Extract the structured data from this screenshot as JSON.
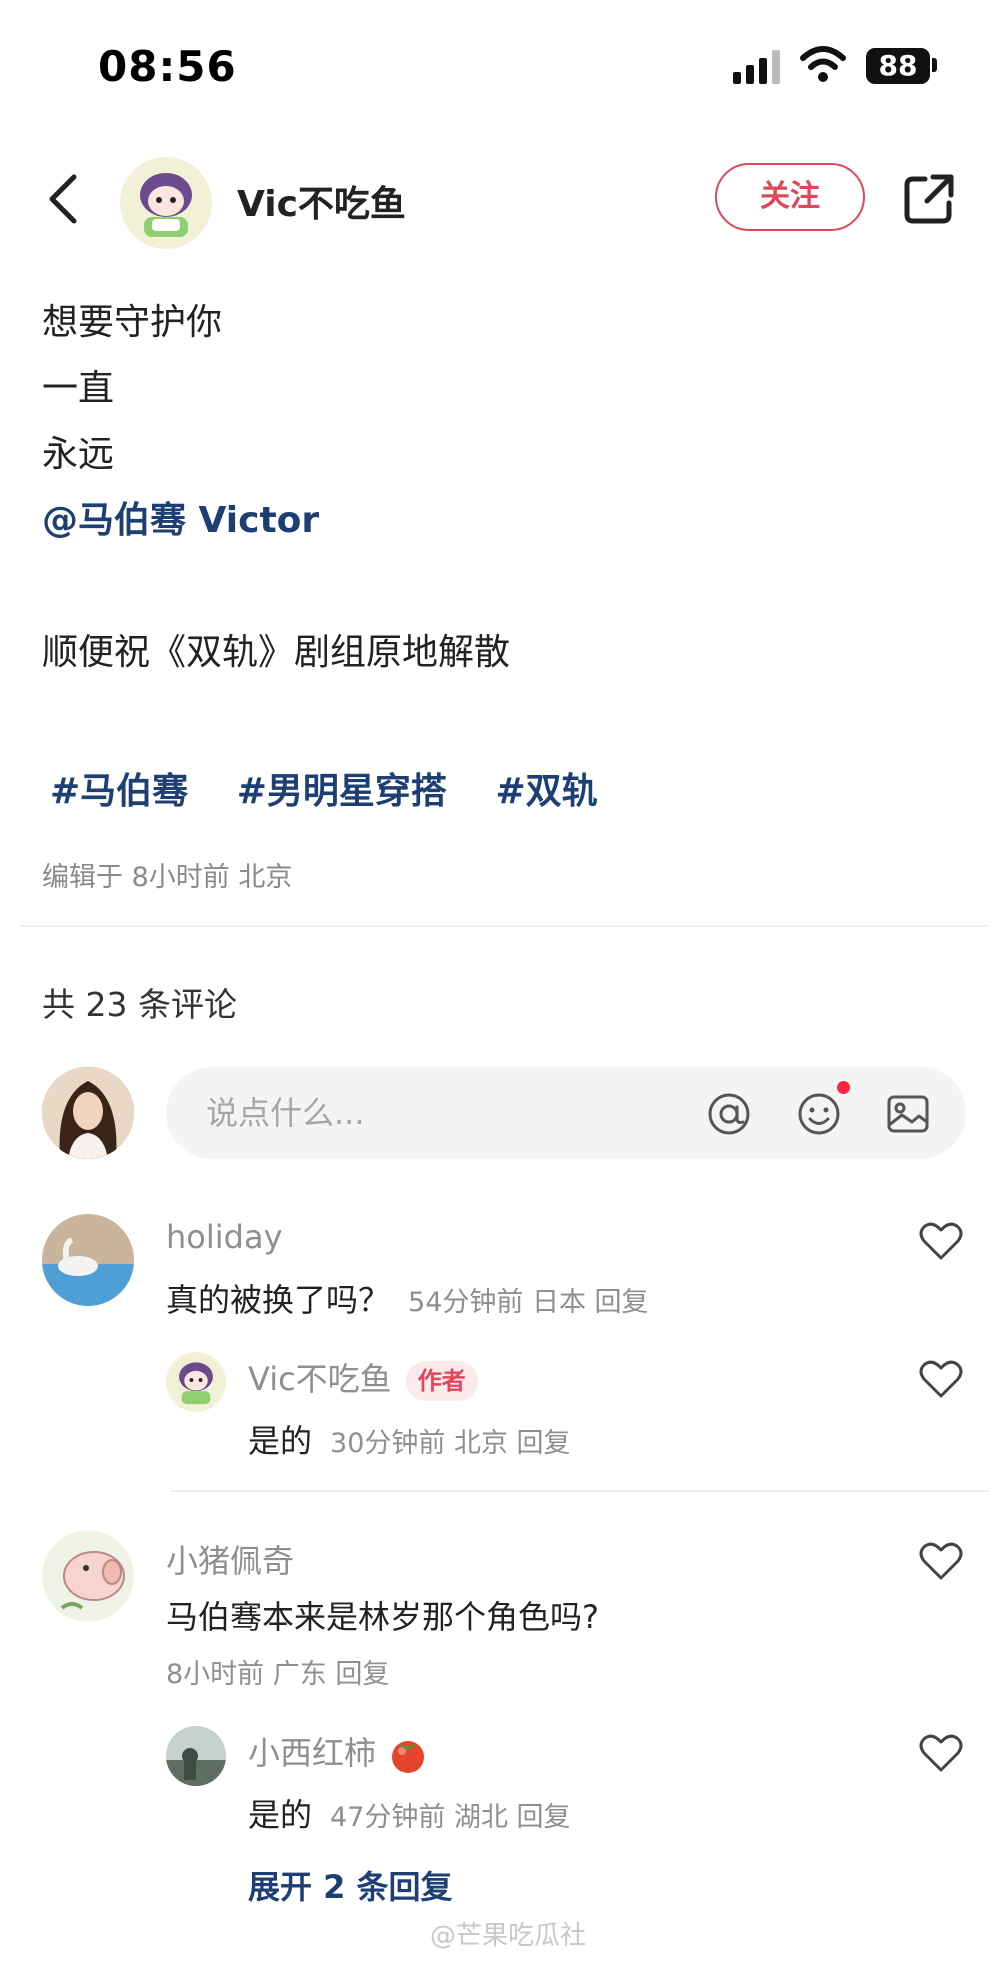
{
  "status_bar": {
    "time": "08:56",
    "battery": "88"
  },
  "header": {
    "author_name": "Vic不吃鱼",
    "follow_label": "关注"
  },
  "post": {
    "lines": [
      "想要守护你",
      "一直",
      "永远"
    ],
    "mention": "@马伯骞 Victor",
    "line_after": "顺便祝《双轨》剧组原地解散",
    "tags": [
      "#马伯骞",
      "#男明星穿搭",
      "#双轨"
    ],
    "edited": "编辑于 8小时前 北京"
  },
  "comments_section": {
    "count_label": "共 23 条评论",
    "input_placeholder": "说点什么..."
  },
  "comments": [
    {
      "name": "holiday",
      "text": "真的被换了吗？",
      "meta": "54分钟前 日本 回复"
    },
    {
      "name": "Vic不吃鱼",
      "badge": "作者",
      "text": "是的",
      "meta": "30分钟前 北京 回复"
    },
    {
      "name": "小猪佩奇",
      "text": "马伯骞本来是林岁那个角色吗?",
      "meta": "8小时前 广东 回复"
    },
    {
      "name": "小西红柿",
      "text": "是的",
      "meta": "47分钟前 湖北 回复"
    }
  ],
  "expand_replies": "展开 2 条回复",
  "watermark": "@芒果吃瓜社",
  "colors": {
    "accent_red": "#e0475a",
    "link_blue": "#1e3f73",
    "meta_gray": "#8f8f8f"
  }
}
